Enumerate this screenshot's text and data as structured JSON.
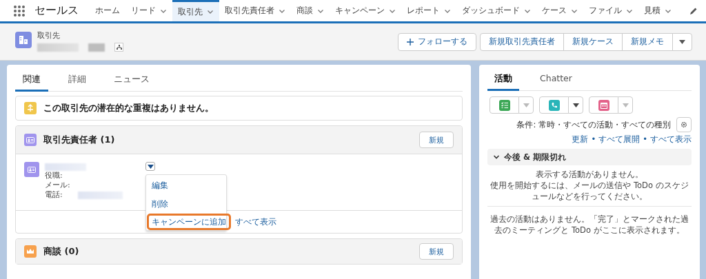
{
  "app": {
    "name": "セールス"
  },
  "nav_items": [
    {
      "label": "ホーム",
      "has_menu": false,
      "selected": false
    },
    {
      "label": "リード",
      "has_menu": true,
      "selected": false
    },
    {
      "label": "取引先",
      "has_menu": true,
      "selected": true
    },
    {
      "label": "取引先責任者",
      "has_menu": true,
      "selected": false
    },
    {
      "label": "商談",
      "has_menu": true,
      "selected": false
    },
    {
      "label": "キャンペーン",
      "has_menu": true,
      "selected": false
    },
    {
      "label": "レポート",
      "has_menu": true,
      "selected": false
    },
    {
      "label": "ダッシュボード",
      "has_menu": true,
      "selected": false
    },
    {
      "label": "ケース",
      "has_menu": true,
      "selected": false
    },
    {
      "label": "ファイル",
      "has_menu": true,
      "selected": false
    },
    {
      "label": "見積",
      "has_menu": true,
      "selected": false
    }
  ],
  "header": {
    "object_type": "取引先",
    "follow_button": "フォローする",
    "actions": [
      "新規取引先責任者",
      "新規ケース",
      "新規メモ"
    ]
  },
  "related": {
    "tabs": [
      {
        "label": "関連",
        "selected": true
      },
      {
        "label": "詳細",
        "selected": false
      },
      {
        "label": "ニュース",
        "selected": false
      }
    ],
    "duplicate_notice": "この取引先の潜在的な重複はありません。",
    "contacts": {
      "title": "取引先責任者 (1)",
      "new_button": "新規",
      "fields": [
        "役職:",
        "メール:",
        "電話:"
      ],
      "menu": [
        {
          "label": "編集",
          "highlighted": false
        },
        {
          "label": "削除",
          "highlighted": false
        },
        {
          "label": "キャンペーンに追加",
          "highlighted": true
        }
      ],
      "view_all": "すべて表示"
    },
    "opportunities": {
      "title": "商談 (0)",
      "new_button": "新規"
    }
  },
  "activity": {
    "tabs": [
      {
        "label": "活動",
        "selected": true
      },
      {
        "label": "Chatter",
        "selected": false
      }
    ],
    "buttons": [
      {
        "kind": "task",
        "caret_enabled": false
      },
      {
        "kind": "call",
        "caret_enabled": true
      },
      {
        "kind": "event",
        "caret_enabled": false
      }
    ],
    "filter": "条件: 常時・すべての活動・すべての種別",
    "links": [
      "更新",
      "すべて展開",
      "すべて表示"
    ],
    "link_separator": "•",
    "upcoming_title": "今後 & 期限切れ",
    "upcoming_empty": [
      "表示する活動がありません。",
      "使用を開始するには、メールの送信や ToDo のスケジュールなどを行ってください。"
    ],
    "past_empty": "過去の活動はありません。「完了」とマークされた過去のミーティングと ToDo がここに表示されます。"
  }
}
